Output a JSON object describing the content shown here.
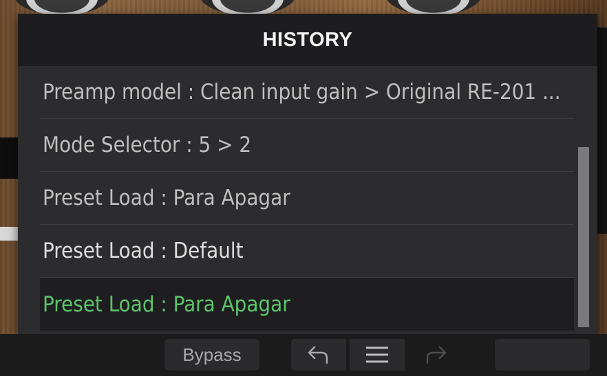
{
  "panel": {
    "title": "HISTORY",
    "items": [
      {
        "label": "Preamp model : Clean input gain > Original RE-201 ..."
      },
      {
        "label": "Mode Selector : 5 > 2"
      },
      {
        "label": "Preset Load : Para Apagar"
      },
      {
        "label": "Preset Load : Default"
      },
      {
        "label": "Preset Load : Para Apagar",
        "current": true
      }
    ]
  },
  "toolbar": {
    "bypass_label": "Bypass",
    "undo_icon": "undo-icon",
    "history_icon": "menu-icon",
    "redo_icon": "redo-icon"
  },
  "colors": {
    "current_item": "#5cc46a",
    "panel_bg": "#2c2c2e",
    "header_bg": "#1d1d1f"
  }
}
